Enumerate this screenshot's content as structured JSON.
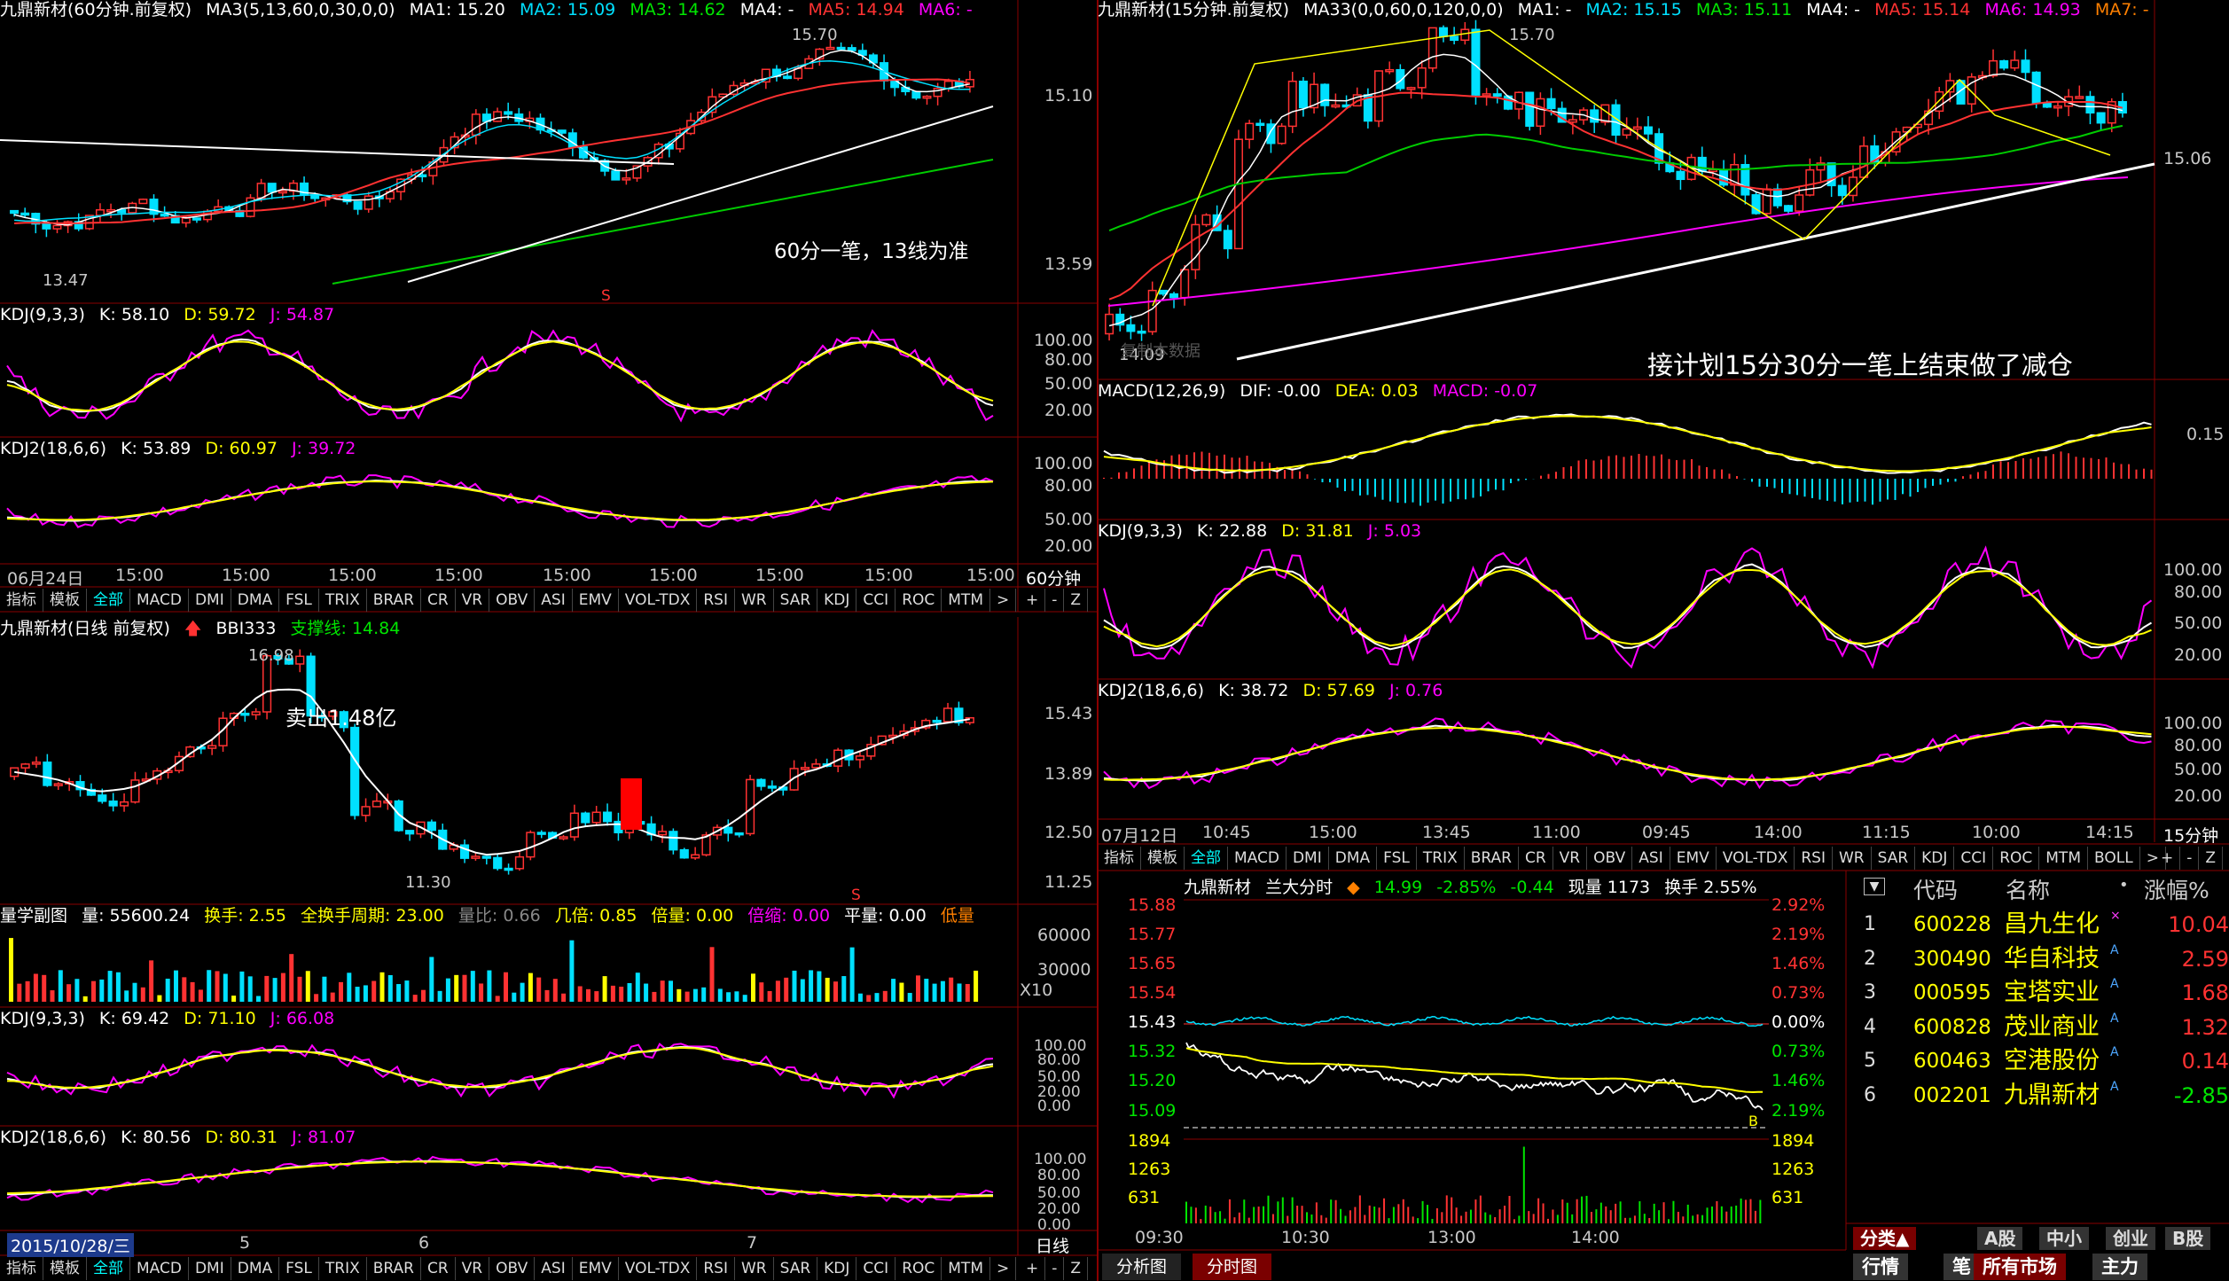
{
  "left_top": {
    "title": "九鼎新材(60分钟.前复权)",
    "ma_label": "MA3(5,13,60,0,30,0,0)",
    "ma1": "MA1: 15.20",
    "ma2": "MA2: 15.09",
    "ma3": "MA3: 14.62",
    "ma4": "MA4: -",
    "ma5": "MA5: 14.94",
    "ma6": "MA6: -",
    "price_hi": "15.10",
    "price_lo": "13.59",
    "peak_label": "15.70",
    "low_label": "13.47",
    "note": "60分一笔，13线为准",
    "s_marker": "S",
    "kdj_title": "KDJ(9,3,3)",
    "kdj_k": "K: 58.10",
    "kdj_d": "D: 59.72",
    "kdj_j": "J: 54.87",
    "kdj_axis": [
      "100.00",
      "80.00",
      "50.00",
      "20.00"
    ],
    "kdj2_title": "KDJ2(18,6,6)",
    "kdj2_k": "K: 53.89",
    "kdj2_d": "D: 60.97",
    "kdj2_j": "J: 39.72",
    "kdj2_axis": [
      "100.00",
      "80.00",
      "50.00",
      "20.00"
    ],
    "time_labels": [
      "06月24日",
      "15:00",
      "15:00",
      "15:00",
      "15:00",
      "15:00",
      "15:00",
      "15:00",
      "15:00",
      "15:00"
    ],
    "period": "60分钟"
  },
  "tabs_row": [
    "指标",
    "模板",
    "全部",
    "MACD",
    "DMI",
    "DMA",
    "FSL",
    "TRIX",
    "BRAR",
    "CR",
    "VR",
    "OBV",
    "ASI",
    "EMV",
    "VOL-TDX",
    "RSI",
    "WR",
    "SAR",
    "KDJ",
    "CCI",
    "ROC",
    "MTM",
    ">"
  ],
  "tab_ctrl": [
    "+",
    "-",
    "Z"
  ],
  "left_daily": {
    "title": "九鼎新材(日线 前复权)",
    "bbi": "BBI333",
    "support": "支撑线: 14.84",
    "peak": "16.98",
    "low": "11.30",
    "note": "卖出1.48亿",
    "axis": [
      "15.43",
      "13.89",
      "12.50",
      "11.25"
    ],
    "s_marker": "S"
  },
  "volume": {
    "title": "量学副图",
    "vol": "量: 55600.24",
    "hs": "换手: 2.55",
    "qhs": "全换手周期: 23.00",
    "lb": "量比: 0.66",
    "jb": "几倍: 0.85",
    "bl": "倍量: 0.00",
    "bs": "倍缩: 0.00",
    "pl": "平量: 0.00",
    "dl": "低量",
    "axis": [
      "60000",
      "30000"
    ],
    "x10": "X10"
  },
  "left_kdj": {
    "title": "KDJ(9,3,3)",
    "k": "K: 69.42",
    "d": "D: 71.10",
    "j": "J: 66.08",
    "axis": [
      "100.00",
      "80.00",
      "50.00",
      "20.00",
      "0.00"
    ]
  },
  "left_kdj2": {
    "title": "KDJ2(18,6,6)",
    "k": "K: 80.56",
    "d": "D: 80.31",
    "j": "J: 81.07",
    "axis": [
      "100.00",
      "80.00",
      "50.00",
      "20.00",
      "0.00"
    ]
  },
  "left_bottom": {
    "date": "2015/10/28/三",
    "marks": [
      "5",
      "6",
      "7"
    ],
    "period": "日线"
  },
  "right_top": {
    "title": "九鼎新材(15分钟.前复权)",
    "ma_label": "MA33(0,0,60,0,120,0,0)",
    "ma1": "MA1: -",
    "ma2": "MA2: 15.15",
    "ma3": "MA3: 15.11",
    "ma4": "MA4: -",
    "ma5": "MA5: 15.14",
    "ma6": "MA6: 14.93",
    "ma7": "MA7: -",
    "peak": "15.70",
    "low": "14.09",
    "axis": "15.06",
    "note": "接计划15分30分一笔上结束做了减仓",
    "watermark": "复制本数据"
  },
  "right_macd": {
    "title": "MACD(12,26,9)",
    "dif": "DIF: -0.00",
    "dea": "DEA: 0.03",
    "macd": "MACD: -0.07",
    "axis": "0.15"
  },
  "right_kdj": {
    "title": "KDJ(9,3,3)",
    "k": "K: 22.88",
    "d": "D: 31.81",
    "j": "J: 5.03",
    "axis": [
      "100.00",
      "80.00",
      "50.00",
      "20.00"
    ]
  },
  "right_kdj2": {
    "title": "KDJ2(18,6,6)",
    "k": "K: 38.72",
    "d": "D: 57.69",
    "j": "J: 0.76",
    "axis": [
      "100.00",
      "80.00",
      "50.00",
      "20.00"
    ]
  },
  "right_time": [
    "07月12日",
    "10:45",
    "15:00",
    "13:45",
    "11:00",
    "09:45",
    "14:00",
    "11:15",
    "10:00",
    "14:15"
  ],
  "right_period": "15分钟",
  "right_tabs": [
    "指标",
    "模板",
    "全部",
    "MACD",
    "DMI",
    "DMA",
    "FSL",
    "TRIX",
    "BRAR",
    "CR",
    "VR",
    "OBV",
    "ASI",
    "EMV",
    "VOL-TDX",
    "RSI",
    "WR",
    "SAR",
    "KDJ",
    "CCI",
    "ROC",
    "MTM",
    "BOLL",
    ">"
  ],
  "intraday": {
    "name": "九鼎新材",
    "board": "兰大分时",
    "price": "14.99",
    "pct": "-2.85%",
    "chg": "-0.44",
    "vol": "现量 1173",
    "hs": "换手 2.55%",
    "left_axis": [
      "15.88",
      "15.77",
      "15.65",
      "15.54",
      "15.43",
      "15.32",
      "15.20",
      "15.09",
      "1894",
      "1263",
      "631"
    ],
    "right_axis": [
      "2.92%",
      "2.19%",
      "1.46%",
      "0.73%",
      "0.00%",
      "0.73%",
      "1.46%",
      "2.19%",
      "1894",
      "1263",
      "631"
    ],
    "time": [
      "09:30",
      "10:30",
      "13:00",
      "14:00"
    ],
    "b_marker": "B"
  },
  "watchlist": {
    "headers": [
      "代码",
      "名称",
      "涨幅%"
    ],
    "rows": [
      {
        "no": "1",
        "code": "600228",
        "name": "昌九生化",
        "chg": "10.04",
        "color": "#ff3232",
        "mark": "×"
      },
      {
        "no": "2",
        "code": "300490",
        "name": "华自科技",
        "chg": "2.59",
        "color": "#ff3232",
        "mark": "A"
      },
      {
        "no": "3",
        "code": "000595",
        "name": "宝塔实业",
        "chg": "1.68",
        "color": "#ff3232",
        "mark": "A"
      },
      {
        "no": "4",
        "code": "600828",
        "name": "茂业商业",
        "chg": "1.32",
        "color": "#ff3232",
        "mark": "A"
      },
      {
        "no": "5",
        "code": "600463",
        "name": "空港股份",
        "chg": "0.14",
        "color": "#ff3232",
        "mark": "A"
      },
      {
        "no": "6",
        "code": "002201",
        "name": "九鼎新材",
        "chg": "-2.85",
        "color": "#00e600",
        "mark": "A"
      }
    ],
    "tabs1": [
      "分类▲",
      "A股",
      "中小",
      "创业",
      "B股"
    ],
    "tabs2": [
      "行情",
      "笔",
      "所有市场",
      "主力"
    ]
  },
  "bottom_right_tabs": [
    "分析图",
    "分时图"
  ]
}
